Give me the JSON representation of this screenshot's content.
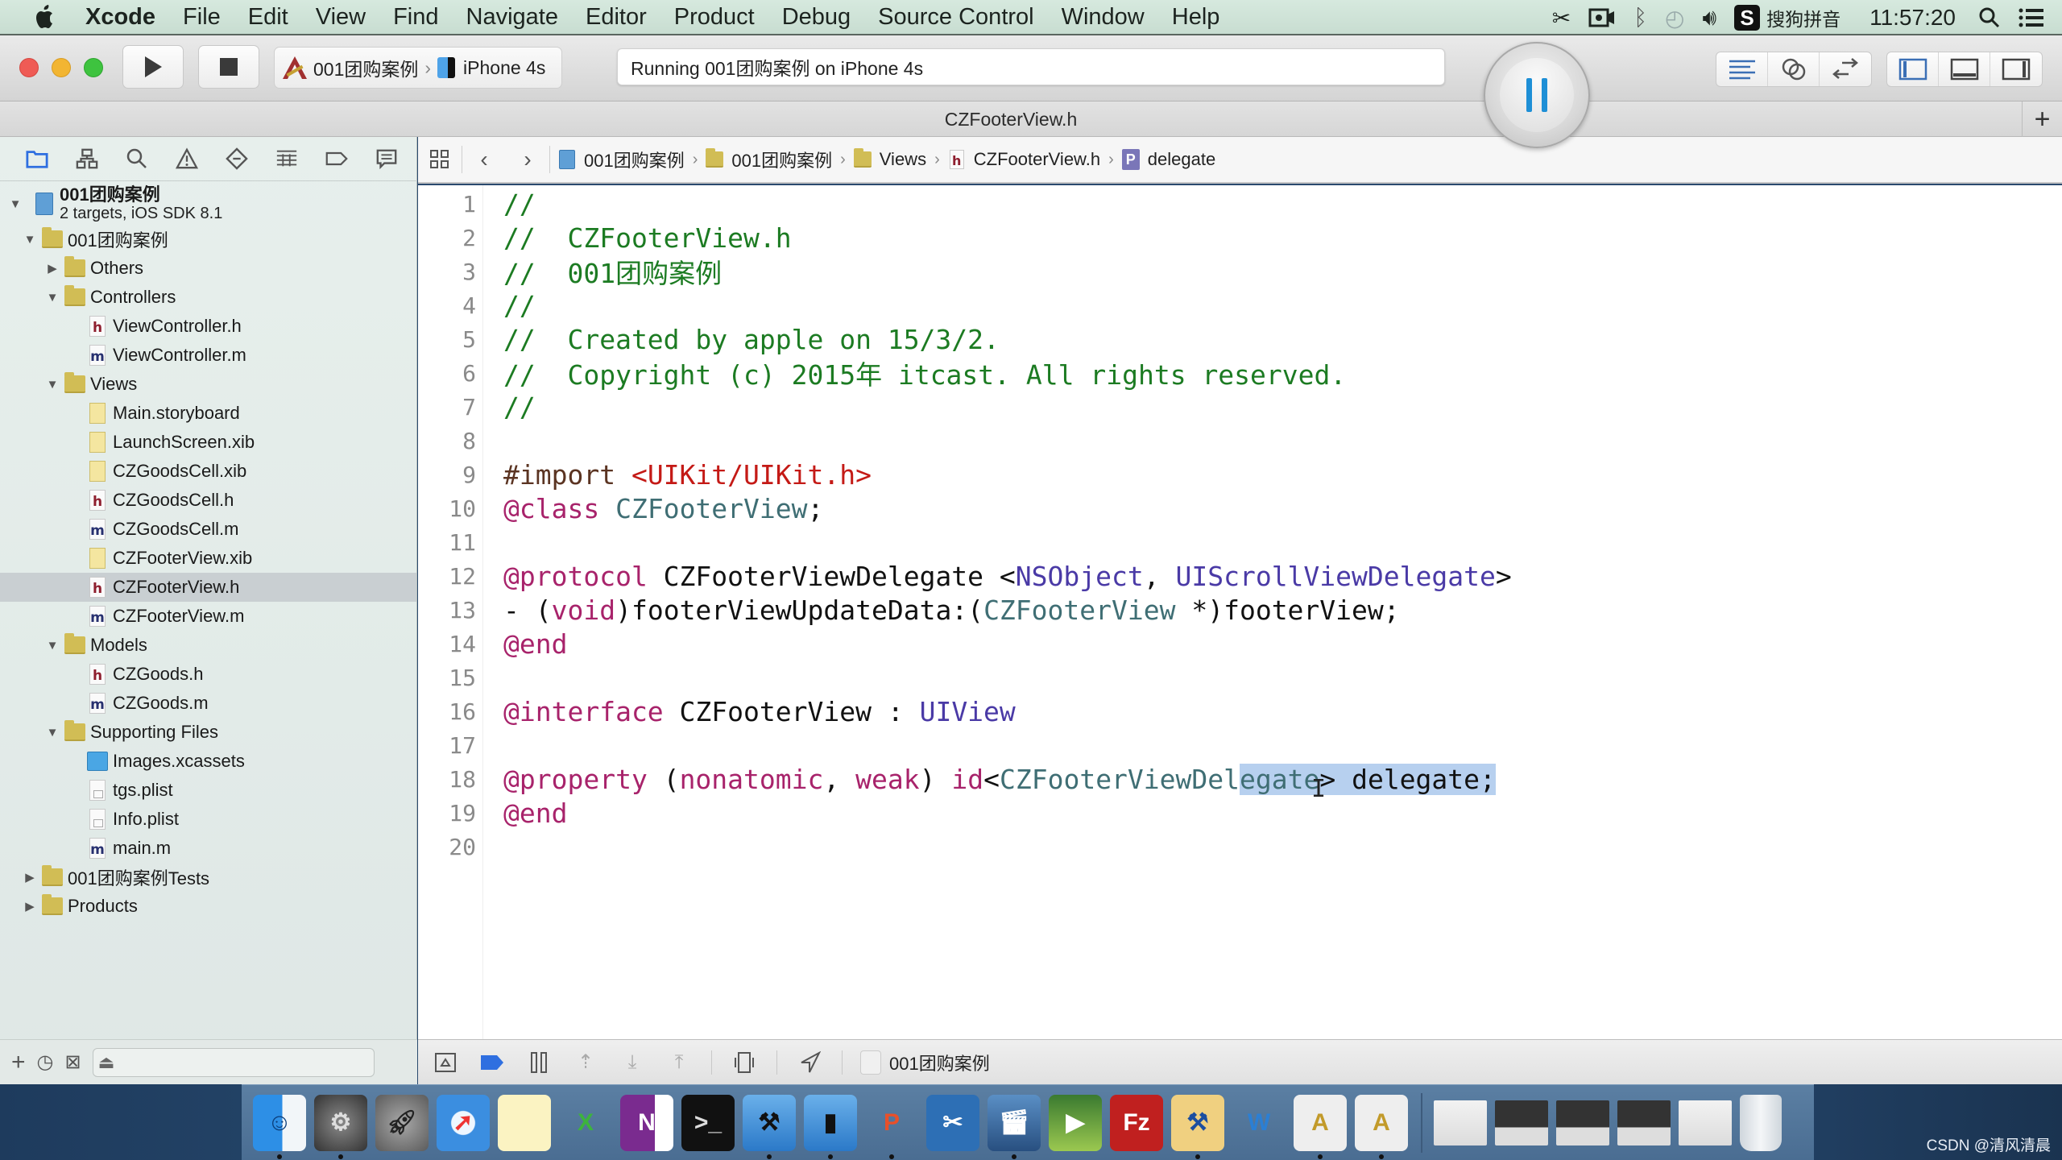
{
  "menubar": {
    "app_name": "Xcode",
    "items": [
      "File",
      "Edit",
      "View",
      "Find",
      "Navigate",
      "Editor",
      "Product",
      "Debug",
      "Source Control",
      "Window",
      "Help"
    ],
    "input_method": "搜狗拼音",
    "clock": "11:57:20",
    "status_icons": [
      "scissors-icon",
      "screen-record-icon",
      "bluetooth-icon",
      "time-machine-icon",
      "volume-icon",
      "sogou-ime-icon",
      "spotlight-icon",
      "notification-list-icon"
    ]
  },
  "toolbar": {
    "scheme": "001团购案例",
    "destination": "iPhone 4s",
    "activity_status": "Running 001团购案例 on iPhone 4s",
    "editor_modes": [
      "standard-editor",
      "assistant-editor",
      "version-editor"
    ],
    "view_toggles": [
      "navigator",
      "debug-area",
      "utilities"
    ]
  },
  "tabbar": {
    "title": "CZFooterView.h",
    "add_tab": "+"
  },
  "navigator": {
    "tabs": [
      "project",
      "symbol",
      "find",
      "issue",
      "test",
      "debug",
      "breakpoint",
      "report"
    ],
    "project": {
      "name": "001团购案例",
      "subtitle": "2 targets, iOS SDK 8.1"
    },
    "tree": [
      {
        "label": "001团购案例",
        "type": "folder",
        "depth": 1,
        "disclosure": "open"
      },
      {
        "label": "Others",
        "type": "folder",
        "depth": 2,
        "disclosure": "closed"
      },
      {
        "label": "Controllers",
        "type": "folder",
        "depth": 2,
        "disclosure": "open"
      },
      {
        "label": "ViewController.h",
        "type": "h",
        "depth": 3
      },
      {
        "label": "ViewController.m",
        "type": "m",
        "depth": 3
      },
      {
        "label": "Views",
        "type": "folder",
        "depth": 2,
        "disclosure": "open"
      },
      {
        "label": "Main.storyboard",
        "type": "xib",
        "depth": 3
      },
      {
        "label": "LaunchScreen.xib",
        "type": "xib",
        "depth": 3
      },
      {
        "label": "CZGoodsCell.xib",
        "type": "xib",
        "depth": 3
      },
      {
        "label": "CZGoodsCell.h",
        "type": "h",
        "depth": 3
      },
      {
        "label": "CZGoodsCell.m",
        "type": "m",
        "depth": 3
      },
      {
        "label": "CZFooterView.xib",
        "type": "xib",
        "depth": 3
      },
      {
        "label": "CZFooterView.h",
        "type": "h",
        "depth": 3,
        "selected": true
      },
      {
        "label": "CZFooterView.m",
        "type": "m",
        "depth": 3
      },
      {
        "label": "Models",
        "type": "folder",
        "depth": 2,
        "disclosure": "open"
      },
      {
        "label": "CZGoods.h",
        "type": "h",
        "depth": 3
      },
      {
        "label": "CZGoods.m",
        "type": "m",
        "depth": 3
      },
      {
        "label": "Supporting Files",
        "type": "folder",
        "depth": 2,
        "disclosure": "open"
      },
      {
        "label": "Images.xcassets",
        "type": "assets",
        "depth": 3
      },
      {
        "label": "tgs.plist",
        "type": "plist",
        "depth": 3
      },
      {
        "label": "Info.plist",
        "type": "plist",
        "depth": 3
      },
      {
        "label": "main.m",
        "type": "m",
        "depth": 3
      },
      {
        "label": "001团购案例Tests",
        "type": "folder",
        "depth": 1,
        "disclosure": "closed"
      },
      {
        "label": "Products",
        "type": "folder",
        "depth": 1,
        "disclosure": "closed"
      }
    ]
  },
  "jumpbar": {
    "crumbs": [
      {
        "label": "001团购案例",
        "icon": "project-icon"
      },
      {
        "label": "001团购案例",
        "icon": "folder-icon"
      },
      {
        "label": "Views",
        "icon": "folder-icon"
      },
      {
        "label": "CZFooterView.h",
        "icon": "header-file-icon"
      },
      {
        "label": "delegate",
        "icon": "property-icon"
      }
    ]
  },
  "editor": {
    "file": "CZFooterView.h",
    "lines": [
      [
        {
          "t": "//",
          "c": "comment"
        }
      ],
      [
        {
          "t": "//  CZFooterView.h",
          "c": "comment"
        }
      ],
      [
        {
          "t": "//  001团购案例",
          "c": "comment"
        }
      ],
      [
        {
          "t": "//",
          "c": "comment"
        }
      ],
      [
        {
          "t": "//  Created by apple on 15/3/2.",
          "c": "comment"
        }
      ],
      [
        {
          "t": "//  Copyright (c) 2015年 itcast. All rights reserved.",
          "c": "comment"
        }
      ],
      [
        {
          "t": "//",
          "c": "comment"
        }
      ],
      [],
      [
        {
          "t": "#import ",
          "c": "preproc"
        },
        {
          "t": "<UIKit/UIKit.h>",
          "c": "string"
        }
      ],
      [
        {
          "t": "@class",
          "c": "keyword"
        },
        {
          "t": " ",
          "c": "plain"
        },
        {
          "t": "CZFooterView",
          "c": "type"
        },
        {
          "t": ";",
          "c": "plain"
        }
      ],
      [],
      [
        {
          "t": "@protocol",
          "c": "keyword"
        },
        {
          "t": " CZFooterViewDelegate <",
          "c": "plain"
        },
        {
          "t": "NSObject",
          "c": "sys"
        },
        {
          "t": ", ",
          "c": "plain"
        },
        {
          "t": "UIScrollViewDelegate",
          "c": "sys"
        },
        {
          "t": ">",
          "c": "plain"
        }
      ],
      [
        {
          "t": "- (",
          "c": "plain"
        },
        {
          "t": "void",
          "c": "keyword"
        },
        {
          "t": ")footerViewUpdateData:(",
          "c": "plain"
        },
        {
          "t": "CZFooterView",
          "c": "type"
        },
        {
          "t": " *)footerView;",
          "c": "plain"
        }
      ],
      [
        {
          "t": "@end",
          "c": "keyword"
        }
      ],
      [],
      [
        {
          "t": "@interface",
          "c": "keyword"
        },
        {
          "t": " CZFooterView : ",
          "c": "plain"
        },
        {
          "t": "UIView",
          "c": "sys"
        }
      ],
      [],
      [
        {
          "t": "@property",
          "c": "keyword"
        },
        {
          "t": " (",
          "c": "plain"
        },
        {
          "t": "nonatomic",
          "c": "keyword"
        },
        {
          "t": ", ",
          "c": "plain"
        },
        {
          "t": "weak",
          "c": "keyword"
        },
        {
          "t": ") ",
          "c": "plain"
        },
        {
          "t": "id",
          "c": "keyword"
        },
        {
          "t": "<",
          "c": "plain"
        },
        {
          "t": "CZFooterViewDel",
          "c": "type"
        },
        {
          "t": "egate",
          "c": "type",
          "sel": true
        },
        {
          "t": "> delegate;",
          "c": "plain",
          "sel": true
        }
      ],
      [
        {
          "t": "@end",
          "c": "keyword"
        }
      ],
      []
    ]
  },
  "debugbar": {
    "process": "001团购案例",
    "buttons": [
      "hide-debug-area",
      "breakpoints-toggle",
      "pause-continue",
      "step-over",
      "step-into",
      "step-out",
      "view-hierarchy",
      "simulate-location"
    ]
  },
  "dock": {
    "apps": [
      "Finder",
      "System Preferences",
      "Launchpad",
      "Safari",
      "Notes",
      "Excel",
      "OneNote",
      "Terminal",
      "Xcode",
      "Simulator",
      "Keynote-P",
      "Screenshot Tool",
      "Video Editor",
      "Installer",
      "FileZilla",
      "Instruments",
      "Wunderlist",
      "Document A",
      "Document B"
    ],
    "minimized": [
      "Window 1",
      "Window 2",
      "Window 3",
      "Window 4",
      "Window 5"
    ],
    "trash": "Trash"
  },
  "watermark": "CSDN @清风清晨",
  "colors": {
    "selection": "#b7d0ef",
    "comment": "#1c7b22",
    "keyword": "#a8236b",
    "string": "#c41a16",
    "accent": "#1e8fd6"
  }
}
